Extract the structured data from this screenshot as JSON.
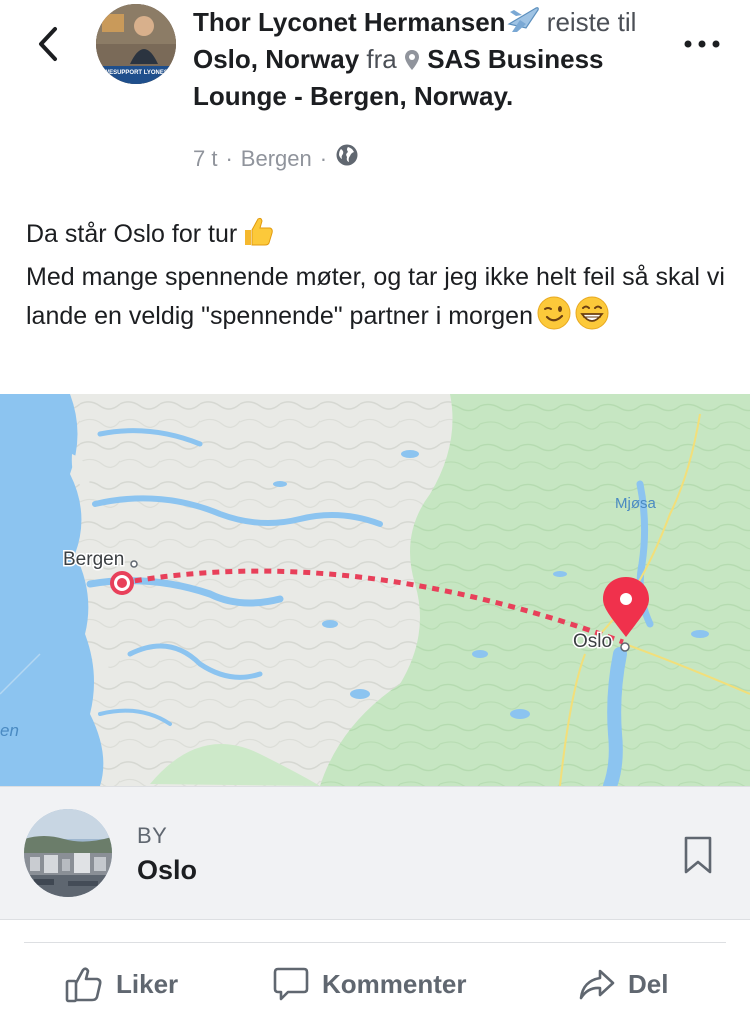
{
  "header": {
    "author": "Thor Lyconet Hermansen",
    "travel_icon": "airplane-icon",
    "verb": "reiste",
    "to_word": "til",
    "destination": "Oslo, Norway",
    "from_word": "fra",
    "origin_icon": "location-pin-icon",
    "origin": "SAS Business Lounge - Bergen, Norway",
    "period": ".",
    "avatar_text": "#WESUPPORT LYONESS",
    "time": "7 t",
    "separator": "·",
    "location": "Bergen",
    "privacy_icon": "globe-icon"
  },
  "post": {
    "line1": "Da står Oslo for tur",
    "line2": "Med mange spennende møter, og tar jeg ikke helt feil så skal vi lande en veldig \"spennende\" partner i morgen"
  },
  "map": {
    "labels": {
      "origin": "Bergen",
      "destination": "Oslo",
      "lake": "Mjøsa",
      "sea": "en"
    }
  },
  "place": {
    "type": "BY",
    "name": "Oslo"
  },
  "actions": {
    "like": "Liker",
    "comment": "Kommenter",
    "share": "Del"
  },
  "colors": {
    "route": "#e8405a",
    "pin": "#f0314c",
    "text_secondary": "#90949c",
    "action_gray": "#606770"
  }
}
